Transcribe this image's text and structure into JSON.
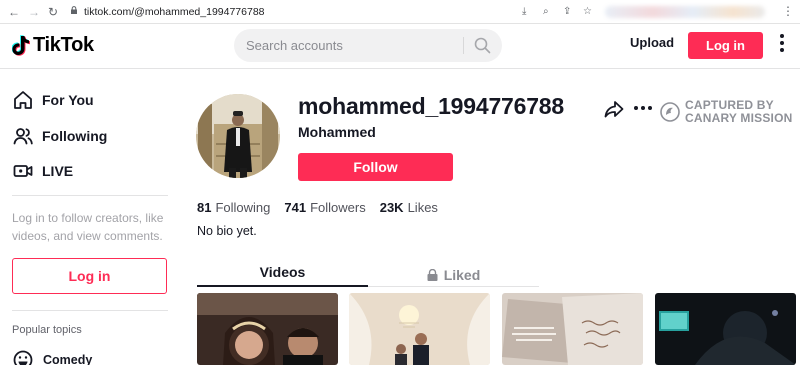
{
  "browser": {
    "url": "tiktok.com/@mohammed_1994776788",
    "back_icon": "arrow-left-icon",
    "forward_icon": "arrow-right-icon",
    "reload_icon": "reload-icon"
  },
  "header": {
    "logo_text": "TikTok",
    "search_placeholder": "Search accounts",
    "upload_label": "Upload",
    "login_label": "Log in"
  },
  "sidebar": {
    "nav": [
      {
        "label": "For You",
        "icon": "home-icon"
      },
      {
        "label": "Following",
        "icon": "users-icon"
      },
      {
        "label": "LIVE",
        "icon": "live-camera-icon"
      }
    ],
    "login_prompt": "Log in to follow creators, like videos, and view comments.",
    "login_button": "Log in",
    "popular_topics_label": "Popular topics",
    "topics": [
      {
        "label": "Comedy",
        "icon": "smile-icon"
      }
    ]
  },
  "profile": {
    "username": "mohammed_1994776788",
    "display_name": "Mohammed",
    "follow_label": "Follow",
    "stats": {
      "following_count": "81",
      "following_label": "Following",
      "followers_count": "741",
      "followers_label": "Followers",
      "likes_count": "23K",
      "likes_label": "Likes"
    },
    "bio": "No bio yet."
  },
  "watermark": {
    "line1": "CAPTURED BY",
    "line2": "CANARY MISSION"
  },
  "tabs": [
    {
      "label": "Videos",
      "active": true
    },
    {
      "label": "Liked",
      "active": false,
      "icon": "lock-icon"
    }
  ],
  "colors": {
    "brand": "#fe2c55",
    "text": "#161823",
    "muted": "#8a8b91"
  }
}
